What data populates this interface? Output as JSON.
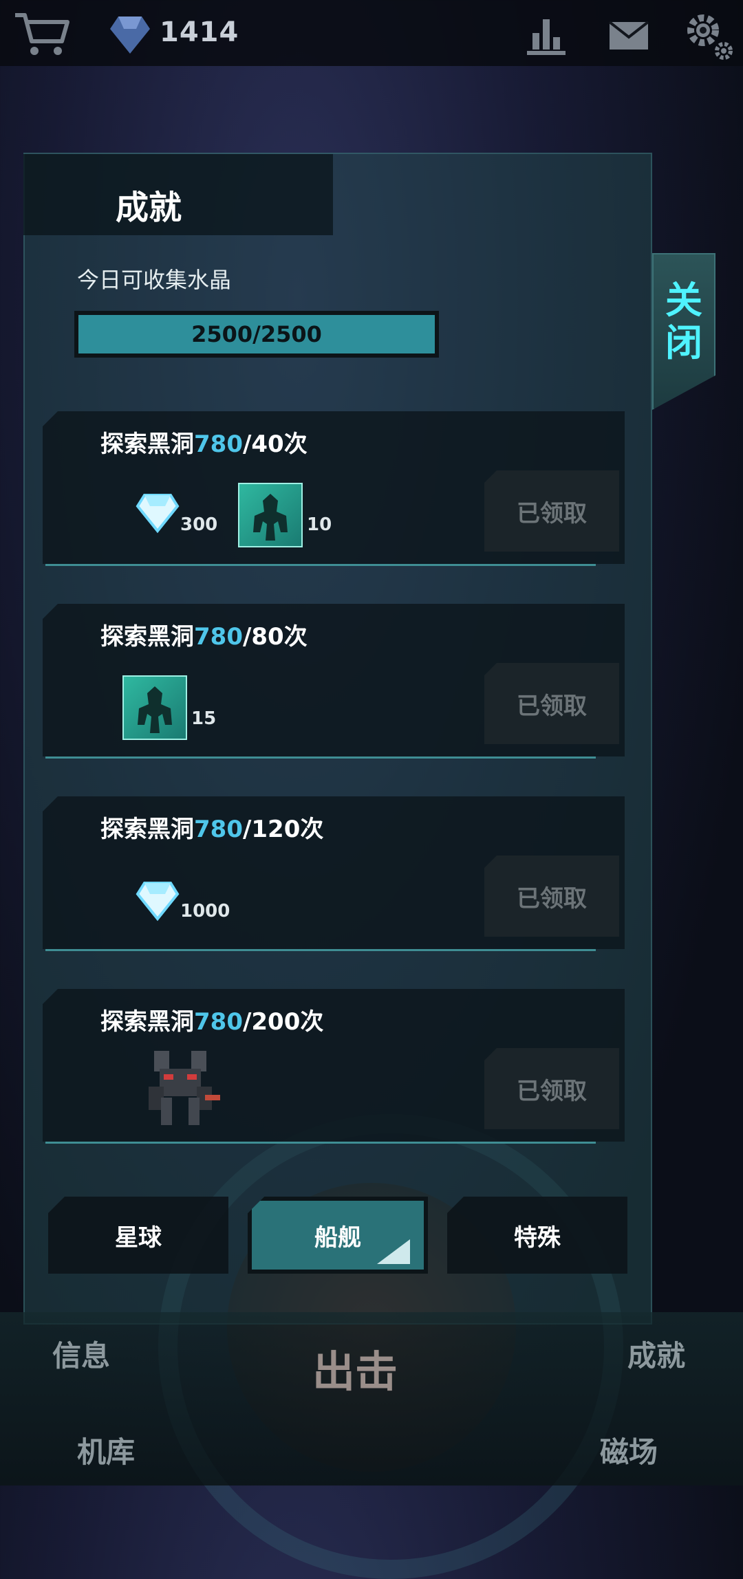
{
  "header": {
    "cart_icon": "cart-icon",
    "crystal_icon": "crystal-icon",
    "crystal_count": "1414",
    "ranking_icon": "ranking-icon",
    "mail_icon": "mail-icon",
    "settings_icon": "gear-icon"
  },
  "panel": {
    "title": "成就",
    "close_label_1": "关",
    "close_label_2": "闭",
    "collect_label": "今日可收集水晶",
    "progress_text": "2500/2500",
    "progress_fraction": 1.0
  },
  "achievements": [
    {
      "title_prefix": "探索黑洞",
      "current": "780",
      "target": "/40次",
      "rewards": [
        {
          "type": "crystal",
          "qty": "300"
        },
        {
          "type": "mech-card",
          "qty": "10"
        }
      ],
      "status": "已领取"
    },
    {
      "title_prefix": "探索黑洞",
      "current": "780",
      "target": "/80次",
      "rewards": [
        {
          "type": "mech-card",
          "qty": "15"
        }
      ],
      "status": "已领取"
    },
    {
      "title_prefix": "探索黑洞",
      "current": "780",
      "target": "/120次",
      "rewards": [
        {
          "type": "crystal",
          "qty": "1000"
        }
      ],
      "status": "已领取"
    },
    {
      "title_prefix": "探索黑洞",
      "current": "780",
      "target": "/200次",
      "rewards": [
        {
          "type": "mech-robot",
          "qty": ""
        }
      ],
      "status": "已领取"
    }
  ],
  "categories": [
    {
      "label": "星球",
      "active": false
    },
    {
      "label": "船舰",
      "active": true
    },
    {
      "label": "特殊",
      "active": false
    }
  ],
  "bottom_nav": {
    "info": "信息",
    "sortie": "出击",
    "achievements": "成就",
    "hangar": "机库",
    "magnetic_field": "磁场"
  },
  "colors": {
    "accent": "#4ff3ff",
    "progress_fill": "#2e8f9b",
    "highlight_number": "#4fc6ea"
  }
}
